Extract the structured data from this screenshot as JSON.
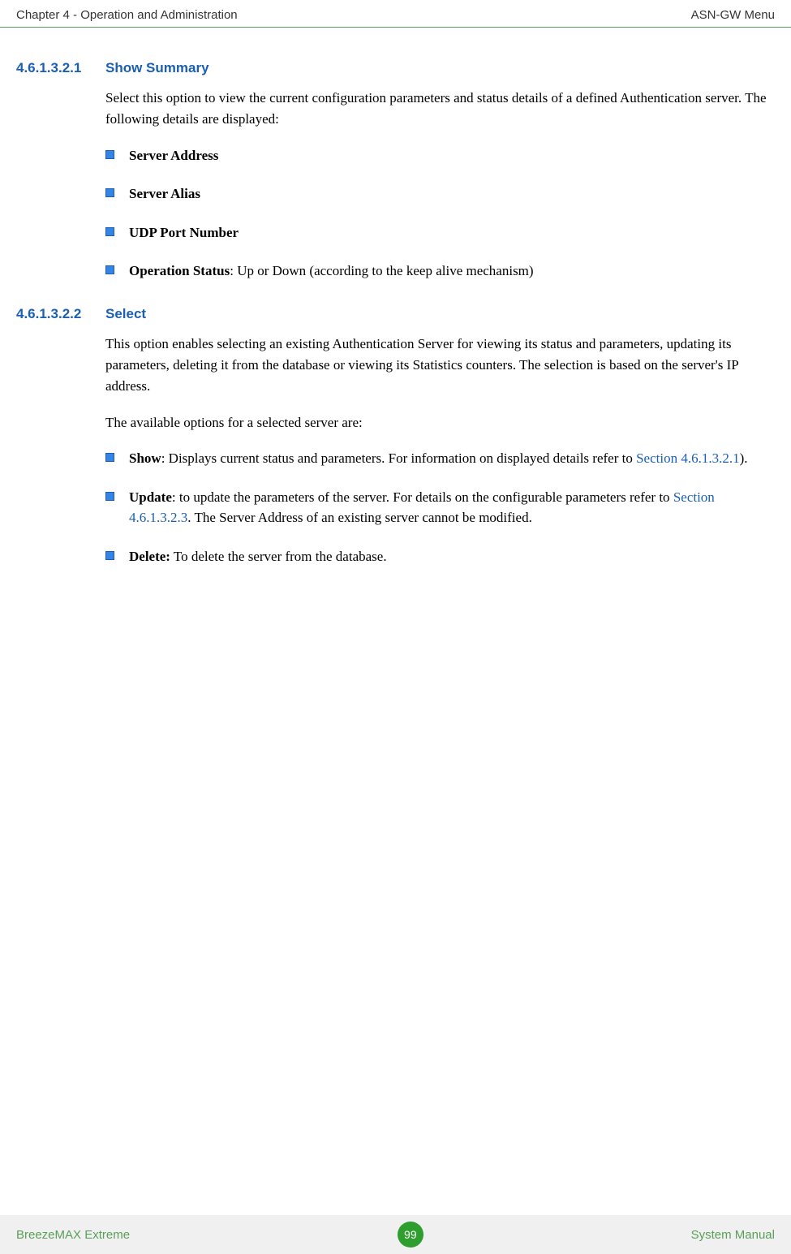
{
  "header": {
    "left": "Chapter 4 - Operation and Administration",
    "right": "ASN-GW Menu"
  },
  "sections": [
    {
      "number": "4.6.1.3.2.1",
      "title": "Show Summary",
      "intro": "Select this option to view the current configuration parameters and status details of a defined Authentication server. The following details are displayed:",
      "bullets": [
        {
          "bold": "Server Address",
          "rest": ""
        },
        {
          "bold": "Server Alias",
          "rest": ""
        },
        {
          "bold": "UDP Port Number",
          "rest": ""
        },
        {
          "bold": "Operation Status",
          "rest": ": Up or Down (according to the keep alive mechanism)"
        }
      ]
    },
    {
      "number": "4.6.1.3.2.2",
      "title": "Select",
      "intro": "This option enables selecting an existing Authentication Server for viewing its status and parameters, updating its parameters, deleting it from the database or viewing its Statistics counters. The selection is based on the server's IP address.",
      "intro2": "The available options for a selected server are:",
      "bullets": [
        {
          "bold": "Show",
          "rest1": ": Displays current status and parameters. For information on displayed details refer to ",
          "link": "Section 4.6.1.3.2.1",
          "rest2": ")."
        },
        {
          "bold": "Update",
          "rest1": ": to update the parameters of the server. For details on the configurable parameters refer to ",
          "link": "Section 4.6.1.3.2.3",
          "rest2": ". The Server Address of an existing server cannot be modified."
        },
        {
          "bold": "Delete:",
          "rest": " To delete the server from the database."
        }
      ]
    }
  ],
  "footer": {
    "left": "BreezeMAX Extreme",
    "page": "99",
    "right": "System Manual"
  }
}
